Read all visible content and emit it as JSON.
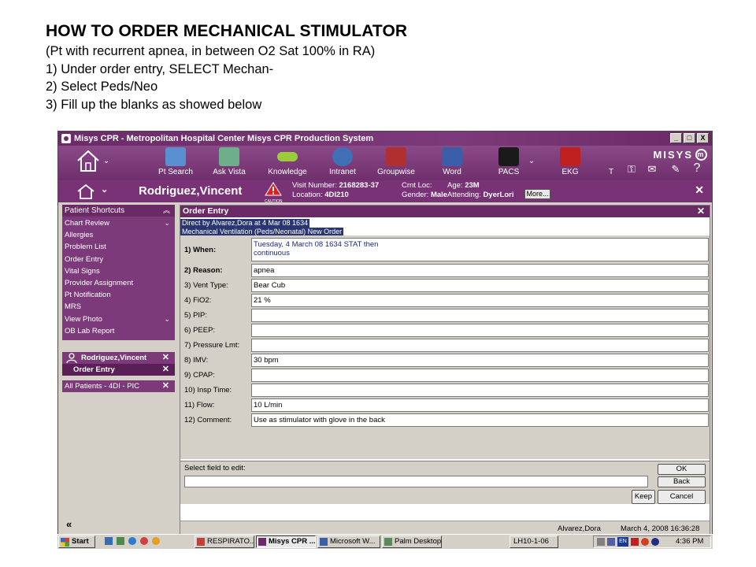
{
  "slide": {
    "title": "HOW TO ORDER MECHANICAL STIMULATOR",
    "lines": [
      "(Pt with recurrent apnea, in between O2 Sat 100% in RA)",
      "1) Under order entry, SELECT Mechan-",
      "2) Select Peds/Neo",
      "3) Fill up the blanks as showed below"
    ]
  },
  "window": {
    "title": "Misys CPR - Metropolitan Hospital Center Misys CPR Production System",
    "controls": [
      "_",
      "□",
      "X"
    ]
  },
  "toolbar": {
    "items": [
      {
        "label": "Pt Search",
        "icon": "pt-search-icon",
        "color": "#5a8fd0"
      },
      {
        "label": "Ask Vista",
        "icon": "ask-vista-icon",
        "color": "#6fae8a"
      },
      {
        "label": "Knowledge",
        "icon": "knowledge-icon",
        "color": "#9ccc3a"
      },
      {
        "label": "Intranet",
        "icon": "intranet-icon",
        "color": "#3f6fb5"
      },
      {
        "label": "Groupwise",
        "icon": "groupwise-icon",
        "color": "#b03030"
      },
      {
        "label": "Word",
        "icon": "word-icon",
        "color": "#3a5fa8"
      },
      {
        "label": "PACS",
        "icon": "pacs-icon",
        "color": "#1a1a1a"
      },
      {
        "label": "EKG",
        "icon": "ekg-icon",
        "color": "#c02020"
      },
      {
        "label": "T",
        "icon": "t-icon",
        "color": "#ffffff"
      }
    ],
    "logo": "MISYS",
    "logo_mark": "m"
  },
  "patient": {
    "name": "Rodriguez,Vincent",
    "caution": "CAUTION",
    "visit_number_label": "Visit Number:",
    "visit_number": "2168283-37",
    "location_label": "Location:",
    "location": "4DI210",
    "crnt_loc_label": "Crnt Loc:",
    "crnt_loc": "",
    "gender_label": "Gender:",
    "gender": "Male",
    "age_label": "Age:",
    "age": "23M",
    "attending_label": "Attending:",
    "attending": "DyerLori",
    "more": "More..."
  },
  "shortcuts": {
    "header": "Patient Shortcuts",
    "items": [
      "Chart Review",
      "Allergies",
      "Problem List",
      "Order Entry",
      "Vital Signs",
      "Provider Assignment",
      "Pt Notification",
      "MRS",
      "View Photo",
      "OB Lab Report"
    ]
  },
  "open_patients": {
    "patient": "Rodriguez,Vincent",
    "task": "Order Entry",
    "list": "All Patients - 4DI - PIC"
  },
  "order_entry": {
    "header": "Order Entry",
    "direct_by": "Direct by Alvarez,Dora at 4 Mar 08  1634",
    "order_name": "Mechanical Ventilation (Peds/Neonatal) New Order",
    "fields": [
      {
        "label": "1) When:",
        "value": "Tuesday, 4 March 08  1634  STAT then",
        "value2": "continuous"
      },
      {
        "label": "2) Reason:",
        "value": "apnea"
      },
      {
        "label": "3) Vent Type:",
        "value": "Bear Cub"
      },
      {
        "label": "4) FiO2:",
        "value": "21 %"
      },
      {
        "label": "5) PIP:",
        "value": ""
      },
      {
        "label": "6) PEEP:",
        "value": ""
      },
      {
        "label": "7) Pressure Lmt:",
        "value": ""
      },
      {
        "label": "8) IMV:",
        "value": "30 bpm"
      },
      {
        "label": "9) CPAP:",
        "value": ""
      },
      {
        "label": "10) Insp Time:",
        "value": ""
      },
      {
        "label": "11) Flow:",
        "value": "10 L/min"
      },
      {
        "label": "12) Comment:",
        "value": "Use as stimulator with glove in the back"
      }
    ],
    "select_label": "Select field to edit:",
    "buttons": {
      "ok": "OK",
      "back": "Back",
      "keep": "Keep",
      "cancel": "Cancel"
    },
    "status_user": "Alvarez,Dora",
    "status_time": "March 4, 2008 16:36:28"
  },
  "collapse_label": "«",
  "taskbar": {
    "start": "Start",
    "tasks": [
      "RESPIRATO...",
      "Misys CPR ...",
      "Microsoft W...",
      "Palm Desktop"
    ],
    "indicator": "LH10-1-06",
    "lang": "EN",
    "clock": "4:36 PM"
  }
}
